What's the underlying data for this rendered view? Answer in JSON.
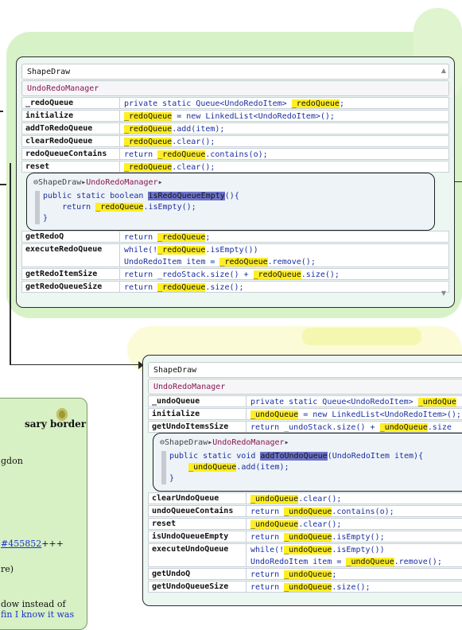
{
  "top": {
    "crumb": "ShapeDraw",
    "class_name": "UndoRedoManager",
    "rows_before": [
      {
        "name": "_redoQueue",
        "code": [
          "private static Queue<UndoRedoItem> ",
          "_redoQueue",
          ";"
        ]
      },
      {
        "name": "initialize",
        "code": [
          "",
          "_redoQueue",
          " = new LinkedList<UndoRedoItem>();"
        ]
      },
      {
        "name": "addToRedoQueue",
        "code": [
          "",
          "_redoQueue",
          ".add(item);"
        ]
      },
      {
        "name": "clearRedoQueue",
        "code": [
          "",
          "_redoQueue",
          ".clear();"
        ]
      },
      {
        "name": "redoQueueContains",
        "code": [
          "return ",
          "_redoQueue",
          ".contains(o);"
        ]
      },
      {
        "name": "reset",
        "code": [
          "",
          "_redoQueue",
          ".clear();"
        ]
      }
    ],
    "bubble": {
      "crumb_prefix": "ShapeDraw",
      "crumb_class": "UndoRedoManager",
      "line1_pre": "public static boolean ",
      "line1_hl": "isRedoQueueEmpty",
      "line1_post": "(){",
      "line2_pre": "    return ",
      "line2_hl": "_redoQueue",
      "line2_post": ".isEmpty();",
      "line3": "}"
    },
    "rows_after": [
      {
        "name": "getRedoQ",
        "code": [
          "return ",
          "_redoQueue",
          ";"
        ]
      },
      {
        "name": "executeRedoQueue",
        "code": [
          "while(!",
          "_redoQueue",
          ".isEmpty())"
        ],
        "code2": [
          "UndoRedoItem item = ",
          "_redoQueue",
          ".remove();"
        ]
      },
      {
        "name": "getRedoItemSize",
        "code": [
          "return _redoStack.size() + ",
          "_redoQueue",
          ".size();"
        ]
      },
      {
        "name": "getRedoQueueSize",
        "code": [
          "return ",
          "_redoQueue",
          ".size();"
        ]
      }
    ]
  },
  "bottom": {
    "crumb": "ShapeDraw",
    "class_name": "UndoRedoManager",
    "rows_before": [
      {
        "name": "_undoQueue",
        "code": [
          "private static Queue<UndoRedoItem> ",
          "_undoQue",
          ""
        ]
      },
      {
        "name": "initialize",
        "code": [
          "",
          "_undoQueue",
          " = new LinkedList<UndoRedoItem>();"
        ]
      },
      {
        "name": "getUndoItemsSize",
        "code": [
          "return _undoStack.size() + ",
          "_undoQueue",
          ".size"
        ]
      }
    ],
    "bubble": {
      "crumb_prefix": "ShapeDraw",
      "crumb_class": "UndoRedoManager",
      "line1_pre": "public static void ",
      "line1_hl": "addToUndoQueue",
      "line1_post": "(UndoRedoItem item){",
      "line2_pre": "    ",
      "line2_hl": "_undoQueue",
      "line2_post": ".add(item);",
      "line3": "}"
    },
    "rows_after": [
      {
        "name": "clearUndoQueue",
        "code": [
          "",
          "_undoQueue",
          ".clear();"
        ]
      },
      {
        "name": "undoQueueContains",
        "code": [
          "return ",
          "_undoQueue",
          ".contains(o);"
        ]
      },
      {
        "name": "reset",
        "code": [
          "",
          "_undoQueue",
          ".clear();"
        ]
      },
      {
        "name": "isUndoQueueEmpty",
        "code": [
          "return ",
          "_undoQueue",
          ".isEmpty();"
        ]
      },
      {
        "name": "executeUndoQueue",
        "code": [
          "while(!",
          "_undoQueue",
          ".isEmpty())"
        ],
        "code2": [
          "UndoRedoItem item = ",
          "_undoQueue",
          ".remove();"
        ]
      },
      {
        "name": "getUndoQ",
        "code": [
          "return ",
          "_undoQueue",
          ";"
        ]
      },
      {
        "name": "getUndoQueueSize",
        "code": [
          "return ",
          "_undoQueue",
          ".size();"
        ]
      }
    ]
  },
  "note": {
    "heading": "sary border",
    "line1": "gdon",
    "link": "#455852",
    "link_suffix": "+++",
    "line2": "re)",
    "line3": "dow instead of",
    "line4": "fin  I know it was"
  },
  "colors": {
    "highlight": "#ffee22",
    "selected": "#6d72c9",
    "class_name": "#8a1550",
    "code": "#1a2fa0"
  }
}
